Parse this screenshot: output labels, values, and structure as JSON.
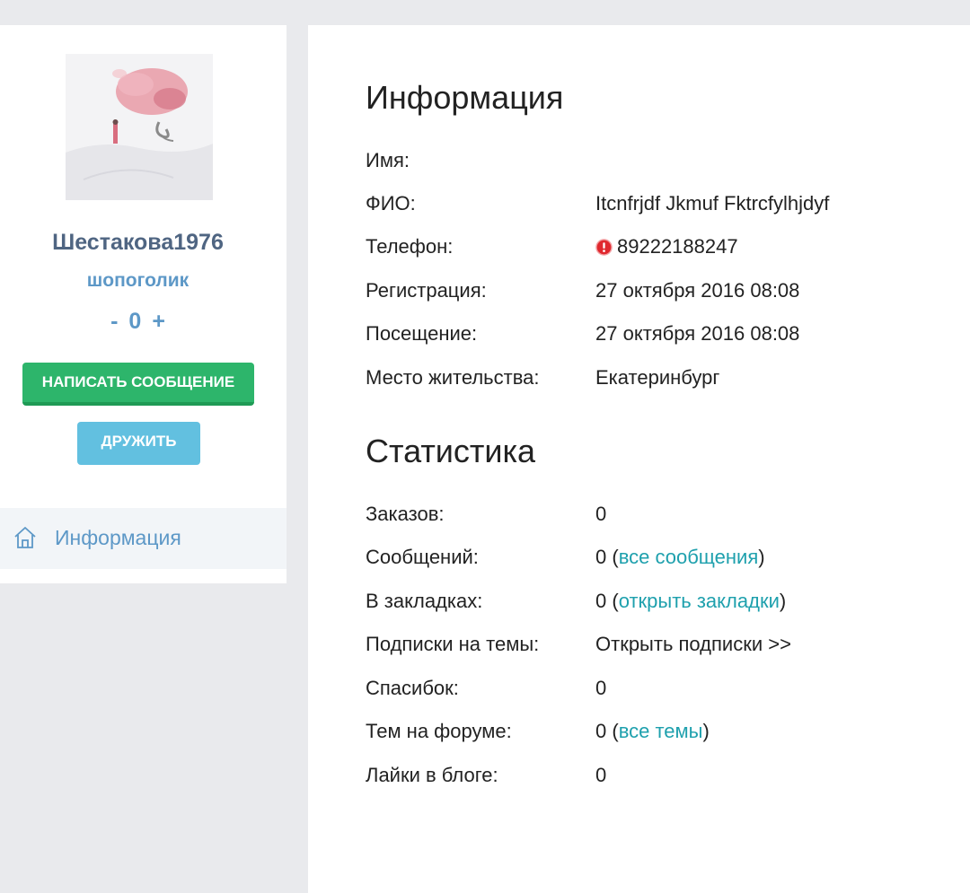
{
  "profile": {
    "username": "Шестакова1976",
    "status": "шопоголик",
    "rating": {
      "minus": "-",
      "value": "0",
      "plus": "+"
    },
    "buttons": {
      "message": "НАПИСАТЬ СООБЩЕНИЕ",
      "friend": "ДРУЖИТЬ"
    },
    "nav": [
      {
        "label": "Информация",
        "icon": "home-icon"
      }
    ]
  },
  "info": {
    "title": "Информация",
    "rows": [
      {
        "label": "Имя:",
        "value": ""
      },
      {
        "label": "ФИО:",
        "value": "Itcnfrjdf Jkmuf Fktrcfylhjdyf"
      },
      {
        "label": "Телефон:",
        "value": "89222188247",
        "icon": "warning-icon"
      },
      {
        "label": "Регистрация:",
        "value": "27 октября 2016 08:08"
      },
      {
        "label": "Посещение:",
        "value": "27 октября 2016 08:08"
      },
      {
        "label": "Место жительства:",
        "value": "Екатеринбург"
      }
    ]
  },
  "stats": {
    "title": "Статистика",
    "rows": [
      {
        "label": "Заказов:",
        "value": "0"
      },
      {
        "label": "Сообщений:",
        "value": "0 (",
        "link": "все сообщения",
        "suffix": ")"
      },
      {
        "label": "В закладках:",
        "value": "0 (",
        "link": "открыть закладки",
        "suffix": ")"
      },
      {
        "label": "Подписки на темы:",
        "link": "Открыть подписки >>"
      },
      {
        "label": "Спасибок:",
        "value": "0"
      },
      {
        "label": "Тем на форуме:",
        "value": "0 (",
        "link": "все темы",
        "suffix": ")"
      },
      {
        "label": "Лайки в блоге:",
        "value": "0"
      }
    ]
  },
  "colors": {
    "background": "#e9eaed",
    "username": "#4f6582",
    "accent": "#5d98c7",
    "link": "#1ea0ad",
    "message_button": "#2db56b",
    "friend_button": "#62c0e0",
    "warning": "#e0282e"
  }
}
